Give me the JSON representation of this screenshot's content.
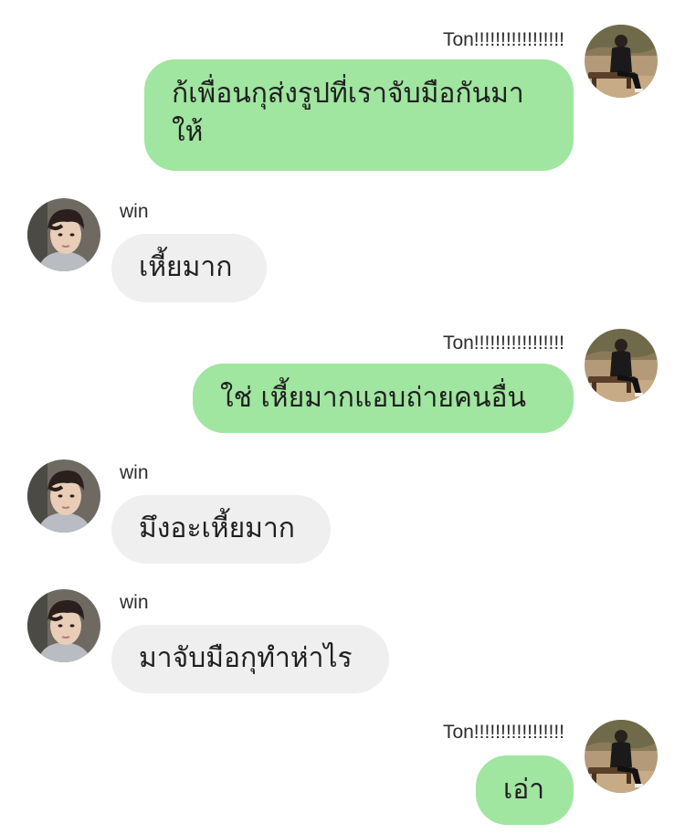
{
  "messages": [
    {
      "direction": "out",
      "sender": "Ton!!!!!!!!!!!!!!!!!",
      "text": "ก้เพื่อนกุส่งรูปที่เราจับมือกันมาให้"
    },
    {
      "direction": "in",
      "sender": "win",
      "text": "เหี้ยมาก"
    },
    {
      "direction": "out",
      "sender": "Ton!!!!!!!!!!!!!!!!!",
      "text": "ใช่ เหี้ยมากแอบถ่ายคนอื่น"
    },
    {
      "direction": "in",
      "sender": "win",
      "text": "มึงอะเหี้ยมาก"
    },
    {
      "direction": "in",
      "sender": "win",
      "text": "มาจับมือกุทำห่าไร"
    },
    {
      "direction": "out",
      "sender": "Ton!!!!!!!!!!!!!!!!!",
      "text": "เอ่า"
    }
  ],
  "colors": {
    "outgoing_bubble": "#a0e5a0",
    "incoming_bubble": "#efefef"
  }
}
